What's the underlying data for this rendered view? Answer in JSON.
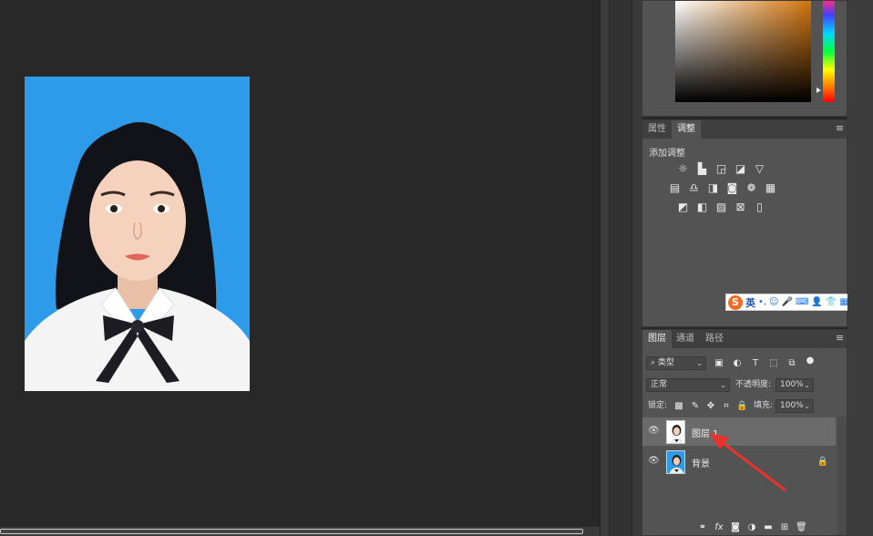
{
  "colors": {
    "canvas_bg": "#282828",
    "panel_bg": "#535353",
    "photo_bg": "#2d9bea",
    "selected_row": "#6b6b6b",
    "annotation_arrow": "#e8322b"
  },
  "adjustments_panel": {
    "tabs": [
      "属性",
      "调整"
    ],
    "active_tab": "调整",
    "title": "添加调整",
    "rows": [
      [
        "brightness-contrast-icon",
        "levels-icon",
        "curves-icon",
        "exposure-icon",
        "vibrance-icon"
      ],
      [
        "hue-saturation-icon",
        "color-balance-icon",
        "black-white-icon",
        "photo-filter-icon",
        "channel-mixer-icon",
        "color-lookup-icon"
      ],
      [
        "invert-icon",
        "posterize-icon",
        "threshold-icon",
        "selective-color-icon",
        "gradient-map-icon"
      ]
    ]
  },
  "ime_toolbar": {
    "logo": "S",
    "lang": "英",
    "items": [
      "•,",
      "☺",
      "🎤",
      "⌨",
      "👤",
      "👕",
      "▦"
    ]
  },
  "layers_panel": {
    "tabs": [
      "图层",
      "通道",
      "路径"
    ],
    "active_tab": "图层",
    "filter_select": "类型",
    "blend_mode": "正常",
    "opacity_label": "不透明度:",
    "opacity_value": "100%",
    "lock_label": "锁定:",
    "fill_label": "填充:",
    "fill_value": "100%",
    "layers": [
      {
        "name": "图层 1",
        "selected": true,
        "locked": false
      },
      {
        "name": "背景",
        "selected": false,
        "locked": true
      }
    ],
    "footer_icons": [
      "link-icon",
      "fx-icon",
      "mask-icon",
      "adjustment-layer-icon",
      "group-folder-icon",
      "new-layer-icon",
      "trash-icon"
    ]
  }
}
